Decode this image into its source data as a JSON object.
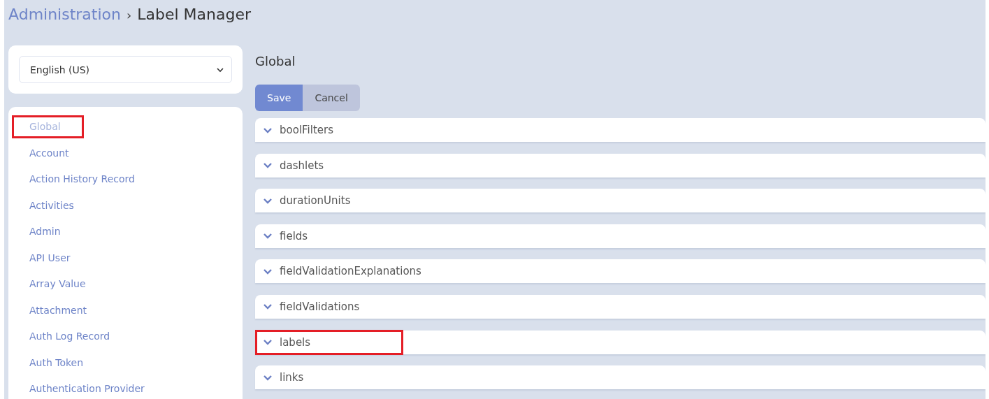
{
  "breadcrumb": {
    "parent": "Administration",
    "separator": "›",
    "current": "Label Manager"
  },
  "language_select": {
    "value": "English (US)"
  },
  "sidebar": {
    "items": [
      {
        "label": "Global",
        "selected": true,
        "highlighted": true
      },
      {
        "label": "Account",
        "selected": false,
        "highlighted": false
      },
      {
        "label": "Action History Record",
        "selected": false,
        "highlighted": false
      },
      {
        "label": "Activities",
        "selected": false,
        "highlighted": false
      },
      {
        "label": "Admin",
        "selected": false,
        "highlighted": false
      },
      {
        "label": "API User",
        "selected": false,
        "highlighted": false
      },
      {
        "label": "Array Value",
        "selected": false,
        "highlighted": false
      },
      {
        "label": "Attachment",
        "selected": false,
        "highlighted": false
      },
      {
        "label": "Auth Log Record",
        "selected": false,
        "highlighted": false
      },
      {
        "label": "Auth Token",
        "selected": false,
        "highlighted": false
      },
      {
        "label": "Authentication Provider",
        "selected": false,
        "highlighted": false
      }
    ]
  },
  "content": {
    "title": "Global",
    "buttons": [
      {
        "label": "Save",
        "kind": "primary"
      },
      {
        "label": "Cancel",
        "kind": "secondary"
      }
    ],
    "sections": [
      {
        "label": "boolFilters",
        "expanded": false,
        "highlighted": false
      },
      {
        "label": "dashlets",
        "expanded": false,
        "highlighted": false
      },
      {
        "label": "durationUnits",
        "expanded": false,
        "highlighted": false
      },
      {
        "label": "fields",
        "expanded": false,
        "highlighted": false
      },
      {
        "label": "fieldValidationExplanations",
        "expanded": false,
        "highlighted": false
      },
      {
        "label": "fieldValidations",
        "expanded": false,
        "highlighted": false
      },
      {
        "label": "labels",
        "expanded": false,
        "highlighted": true
      },
      {
        "label": "links",
        "expanded": false,
        "highlighted": false
      }
    ]
  }
}
